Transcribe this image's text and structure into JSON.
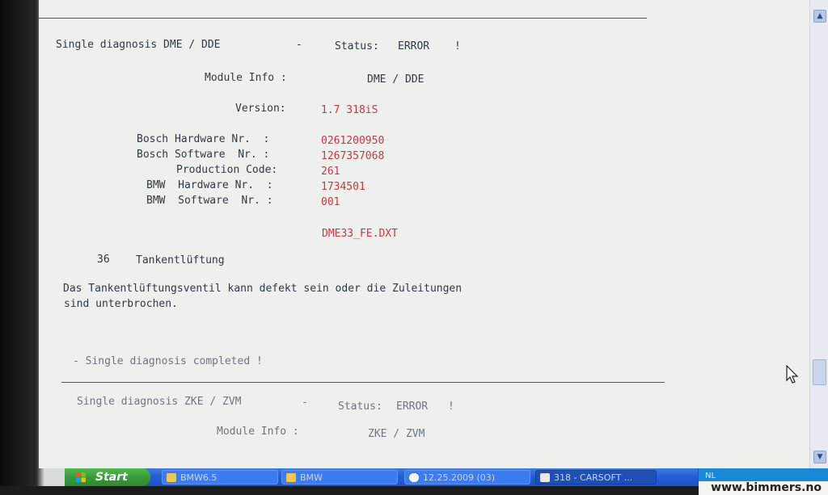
{
  "report1": {
    "title": "Single diagnosis DME / DDE",
    "dash": "-",
    "status_label": "Status:",
    "status_value": "ERROR",
    "status_mark": "!",
    "module_info_label": "Module Info :",
    "module_info_value": "DME / DDE",
    "version_label": "Version:",
    "version_value": "1.7 318iS",
    "fields": [
      {
        "label": "Bosch Hardware Nr.  :",
        "value": "0261200950"
      },
      {
        "label": "Bosch Software  Nr. :",
        "value": "1267357068"
      },
      {
        "label": "Production Code:",
        "value": "261"
      },
      {
        "label": "BMW  Hardware Nr.  :",
        "value": "1734501"
      },
      {
        "label": "BMW  Software  Nr. :",
        "value": "001"
      }
    ],
    "file": "DME33_FE.DXT",
    "fault_code": "36",
    "fault_name": "Tankentlüftung",
    "fault_desc_line1": "Das Tankentlüftungsventil kann defekt sein oder die Zuleitungen",
    "fault_desc_line2": "sind unterbrochen.",
    "completed": "- Single diagnosis completed !"
  },
  "report2": {
    "title": "Single diagnosis ZKE / ZVM",
    "dash": "-",
    "status_label": "Status:",
    "status_value": "ERROR",
    "status_mark": "!",
    "module_info_label": "Module Info :",
    "module_info_value": "ZKE / ZVM"
  },
  "taskbar": {
    "start_label": "Start",
    "tasks": [
      {
        "label": "BMW6.5"
      },
      {
        "label": "BMW"
      },
      {
        "label": "12.25.2009 (03)"
      },
      {
        "label": "318 - CARSOFT ..."
      }
    ],
    "tray_text": "NL"
  },
  "watermark": "www.bimmers.no",
  "colors": {
    "value_red": "#c23a45",
    "text_dark": "#2e3a44",
    "screen_bg": "#eef0ee",
    "taskbar_blue": "#245edb",
    "start_green": "#3a9b3a"
  },
  "icons": {
    "scroll_up": "chevron-up-icon",
    "scroll_down": "chevron-down-icon",
    "cursor": "mouse-pointer-icon",
    "start_logo": "windows-logo-icon"
  }
}
